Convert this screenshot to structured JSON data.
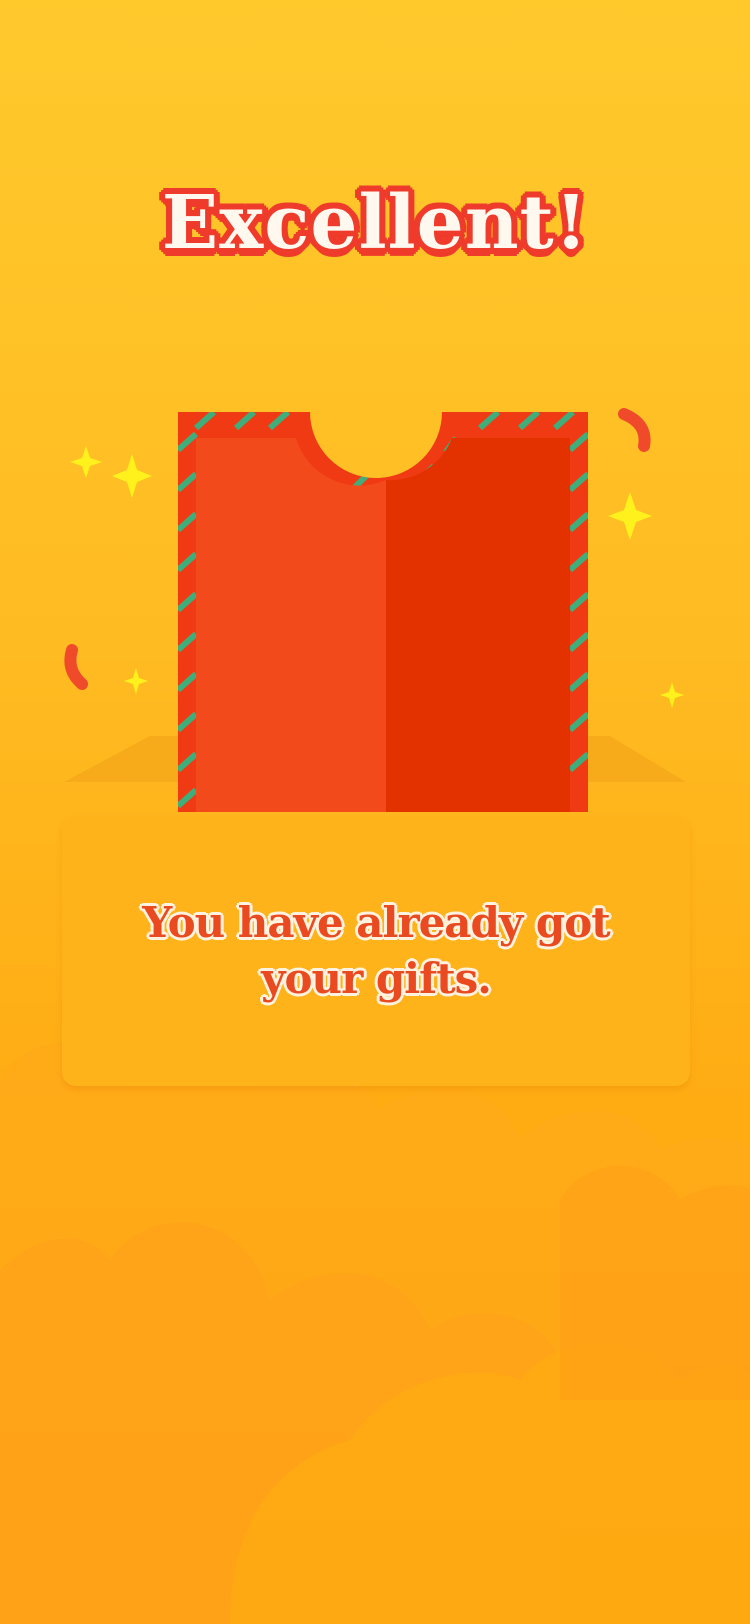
{
  "screen": {
    "title": "Excellent!",
    "message": "You have already got your gifts."
  },
  "colors": {
    "background_top": "#ffc92c",
    "background_bottom": "#ff9f0a",
    "title_text": "#fff8ee",
    "title_outline": "#ef3b2b",
    "envelope_left": "#f24a1a",
    "envelope_right": "#e33200",
    "envelope_border": "#f03a14",
    "envelope_stripe": "#3fae7a",
    "card_background": "#ffb31b",
    "message_text": "#ea4a20",
    "message_outline": "#fff3df",
    "sparkle": "#fff21c",
    "confetti": "#ef4a2a"
  },
  "icons": {
    "gift": "gift-envelope-icon",
    "sparkle": "sparkle-icon",
    "confetti": "confetti-icon"
  }
}
